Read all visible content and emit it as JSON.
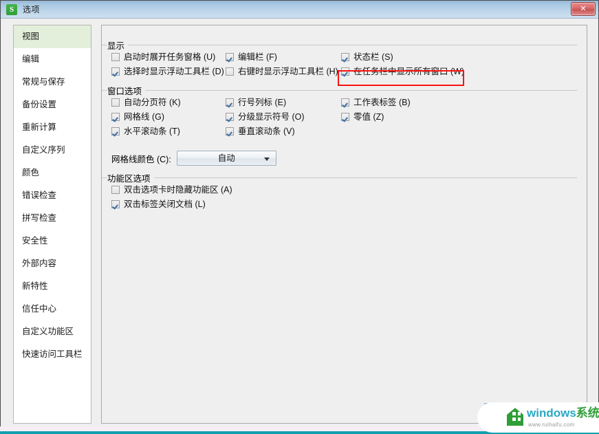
{
  "window": {
    "title": "选项",
    "app_icon": "S",
    "app_icon_name": "wps-spreadsheet-icon",
    "close_label": "✕",
    "titlebar_gradient_from": "#95b8d8",
    "titlebar_gradient_to": "#cfe0ef"
  },
  "sidebar": {
    "selected_index": 0,
    "selected_bg": "#e3efda",
    "items": [
      {
        "label": "视图"
      },
      {
        "label": "编辑"
      },
      {
        "label": "常规与保存"
      },
      {
        "label": "备份设置"
      },
      {
        "label": "重新计算"
      },
      {
        "label": "自定义序列"
      },
      {
        "label": "颜色"
      },
      {
        "label": "错误检查"
      },
      {
        "label": "拼写检查"
      },
      {
        "label": "安全性"
      },
      {
        "label": "外部内容"
      },
      {
        "label": "新特性"
      },
      {
        "label": "信任中心"
      },
      {
        "label": "自定义功能区"
      },
      {
        "label": "快速访问工具栏"
      }
    ]
  },
  "main": {
    "groups": [
      {
        "title": "显示",
        "checkboxes": [
          {
            "label": "启动时展开任务窗格 (U)",
            "checked": false,
            "col": 0,
            "row": 0
          },
          {
            "label": "选择时显示浮动工具栏 (D)",
            "checked": true,
            "col": 0,
            "row": 1
          },
          {
            "label": "编辑栏 (F)",
            "checked": true,
            "col": 1,
            "row": 0
          },
          {
            "label": "右键时显示浮动工具栏 (H)",
            "checked": false,
            "col": 1,
            "row": 1
          },
          {
            "label": "状态栏 (S)",
            "checked": true,
            "col": 2,
            "row": 0
          },
          {
            "label": "在任务栏中显示所有窗口 (W)",
            "checked": true,
            "col": 2,
            "row": 1,
            "highlighted": true
          }
        ]
      },
      {
        "title": "窗口选项",
        "checkboxes": [
          {
            "label": "自动分页符 (K)",
            "checked": false,
            "col": 0,
            "row": 0
          },
          {
            "label": "网格线 (G)",
            "checked": true,
            "col": 0,
            "row": 1
          },
          {
            "label": "水平滚动条 (T)",
            "checked": true,
            "col": 0,
            "row": 2
          },
          {
            "label": "行号列标 (E)",
            "checked": true,
            "col": 1,
            "row": 0
          },
          {
            "label": "分级显示符号 (O)",
            "checked": true,
            "col": 1,
            "row": 1
          },
          {
            "label": "垂直滚动条 (V)",
            "checked": true,
            "col": 1,
            "row": 2
          },
          {
            "label": "工作表标签 (B)",
            "checked": true,
            "col": 2,
            "row": 0
          },
          {
            "label": "零值 (Z)",
            "checked": true,
            "col": 2,
            "row": 1
          }
        ],
        "gridline_color": {
          "label": "网格线颜色 (C):",
          "value": "自动",
          "options": [
            "自动"
          ]
        }
      },
      {
        "title": "功能区选项",
        "checkboxes": [
          {
            "label": "双击选项卡时隐藏功能区 (A)",
            "checked": false,
            "col": 0,
            "row": 0
          },
          {
            "label": "双击标签关闭文档 (L)",
            "checked": true,
            "col": 0,
            "row": 1
          }
        ]
      }
    ]
  },
  "annotation": {
    "highlight_color": "#fb1111",
    "target": "在任务栏中显示所有窗口 (W)"
  },
  "watermark": {
    "text_primary": "windows",
    "text_secondary": "系统家园",
    "url": "www.ruihaifu.com",
    "color_primary": "#2aa8c4",
    "color_secondary": "#2f9e38"
  },
  "footer": {
    "strip_pink": "#f7eef5",
    "strip_teal": "#12a0ae"
  }
}
